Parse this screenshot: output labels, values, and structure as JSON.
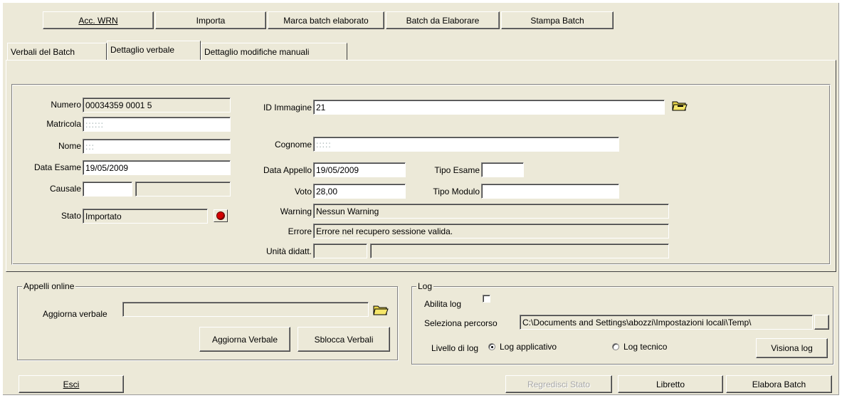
{
  "toolbar": {
    "acc_wrn": "Acc. WRN",
    "importa": "Importa",
    "marca_batch": "Marca batch elaborato",
    "batch_da_elaborare": "Batch da Elaborare",
    "stampa_batch": "Stampa Batch"
  },
  "tabs": [
    {
      "label": "Verbali del Batch"
    },
    {
      "label": "Dettaglio verbale"
    },
    {
      "label": "Dettaglio modifiche manuali"
    }
  ],
  "detail": {
    "numero_label": "Numero",
    "numero_value": "00034359 0001 5",
    "matricola_label": "Matricola",
    "matricola_value": "::::::",
    "nome_label": "Nome",
    "nome_value": ":::",
    "data_esame_label": "Data Esame",
    "data_esame_value": "19/05/2009",
    "causale_label": "Causale",
    "causale_value": "",
    "causale_value2": "",
    "stato_label": "Stato",
    "stato_value": "Importato",
    "id_immagine_label": "ID Immagine",
    "id_immagine_value": "21",
    "cognome_label": "Cognome",
    "cognome_value": ":::::",
    "data_appello_label": "Data Appello",
    "data_appello_value": "19/05/2009",
    "tipo_esame_label": "Tipo Esame",
    "tipo_esame_value": "",
    "voto_label": "Voto",
    "voto_value": "28,00",
    "tipo_modulo_label": "Tipo Modulo",
    "tipo_modulo_value": "",
    "warning_label": "Warning",
    "warning_value": "Nessun Warning",
    "errore_label": "Errore",
    "errore_value": "Errore nel recupero sessione valida.",
    "unita_label": "Unità didatt.",
    "unita_value1": "",
    "unita_value2": ""
  },
  "appelli": {
    "title": "Appelli online",
    "aggiorna_label": "Aggiorna verbale",
    "aggiorna_value": "",
    "aggiorna_button": "Aggiorna Verbale",
    "sblocca_button": "Sblocca Verbali"
  },
  "log": {
    "title": "Log",
    "abilita_label": "Abilita log",
    "abilita_checked": false,
    "percorso_label": "Seleziona percorso",
    "percorso_value": "C:\\Documents and Settings\\abozzi\\Impostazioni locali\\Temp\\",
    "livello_label": "Livello di log",
    "radio_applicativo": "Log applicativo",
    "radio_tecnico": "Log tecnico",
    "selected": "Log applicativo",
    "visiona_button": "Visiona log"
  },
  "footer": {
    "esci": "Esci",
    "regredisci": "Regredisci Stato",
    "libretto": "Libretto",
    "elabora": "Elabora Batch"
  },
  "colors": {
    "face": "#ece9d8",
    "status_led": "#d40000"
  }
}
